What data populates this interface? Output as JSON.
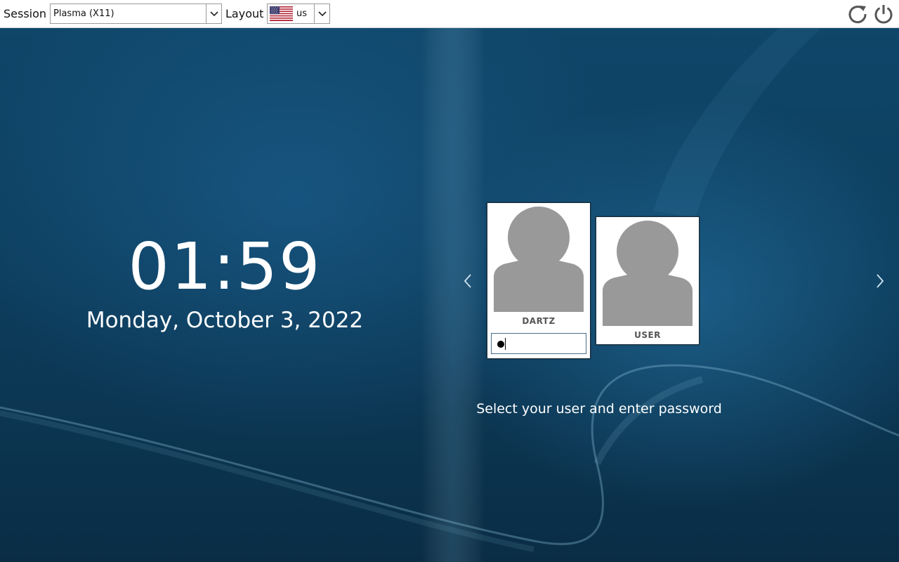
{
  "topbar": {
    "session_label": "Session",
    "session_value": "Plasma (X11)",
    "layout_label": "Layout",
    "layout_value": "us",
    "layout_flag": "us-flag-icon",
    "restart_icon": "restart-icon",
    "shutdown_icon": "power-icon"
  },
  "clock": {
    "time": "01:59",
    "date": "Monday, October 3, 2022"
  },
  "users": [
    {
      "name": "DARTZ",
      "selected": true,
      "password_mask": "●"
    },
    {
      "name": "USER",
      "selected": false
    }
  ],
  "hint": "Select your user and enter password",
  "nav": {
    "prev_icon": "chevron-left-icon",
    "next_icon": "chevron-right-icon"
  }
}
